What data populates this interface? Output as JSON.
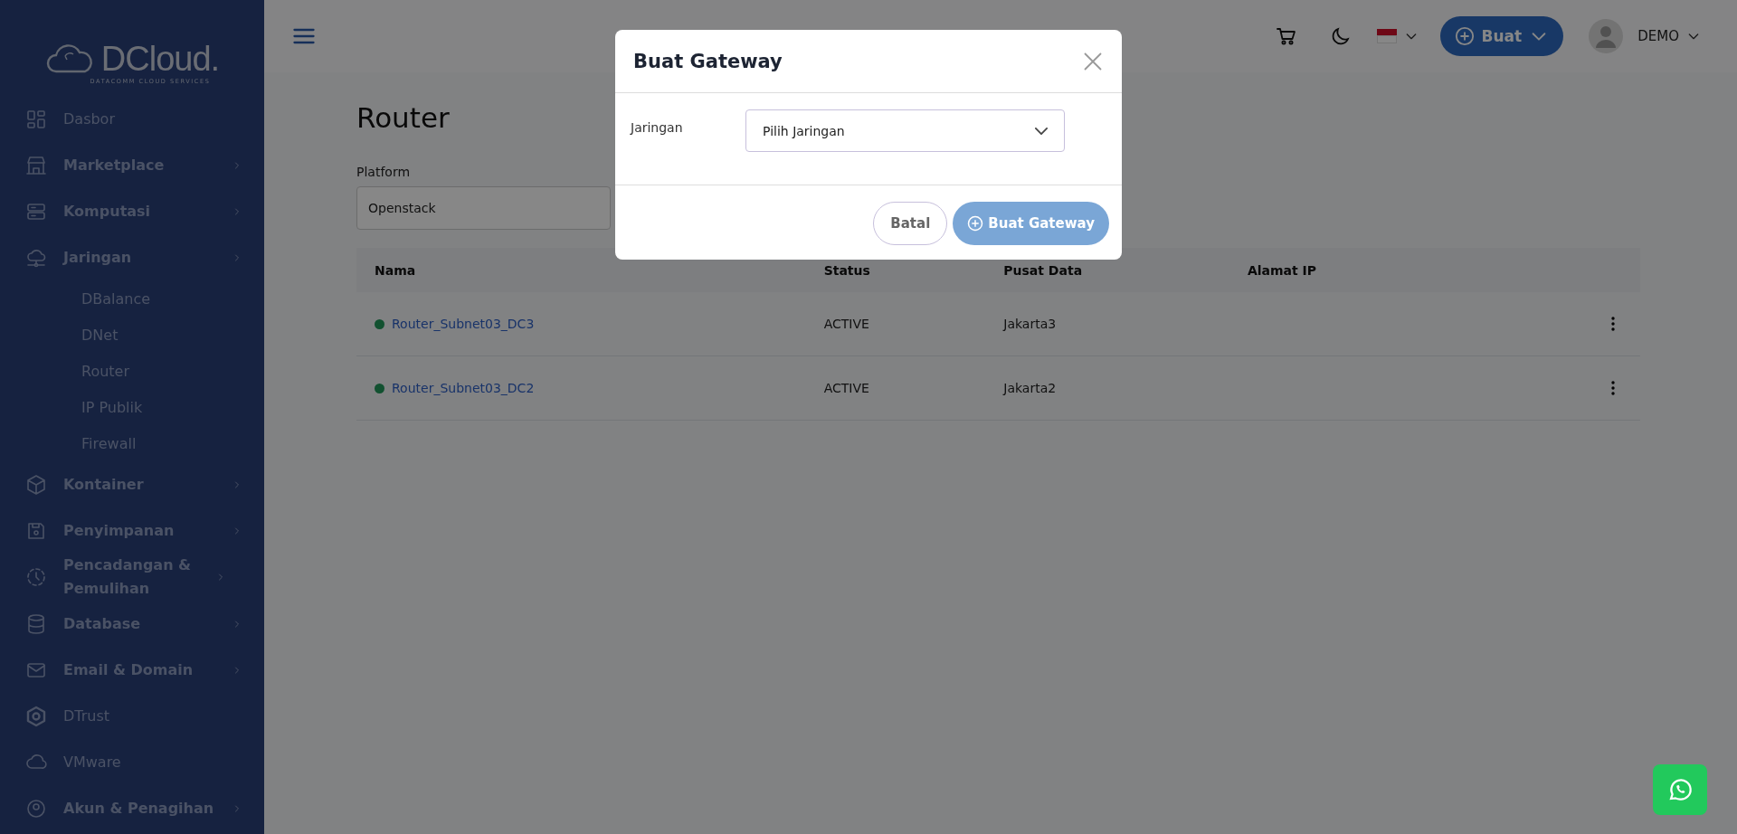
{
  "sidebar": {
    "logo": {
      "name": "DCloud.",
      "tagline": "DATACOMM CLOUD SERVICES"
    },
    "items": [
      {
        "label": "Dasbor",
        "expandable": false
      },
      {
        "label": "Marketplace",
        "expandable": true
      },
      {
        "label": "Komputasi",
        "expandable": true
      },
      {
        "label": "Jaringan",
        "expandable": true,
        "children": [
          {
            "label": "DBalance"
          },
          {
            "label": "DNet"
          },
          {
            "label": "Router"
          },
          {
            "label": "IP Publik"
          },
          {
            "label": "Firewall"
          }
        ]
      },
      {
        "label": "Kontainer",
        "expandable": true
      },
      {
        "label": "Penyimpanan",
        "expandable": true
      },
      {
        "label": "Pencadangan & Pemulihan",
        "expandable": true
      },
      {
        "label": "Database",
        "expandable": true
      },
      {
        "label": "Email & Domain",
        "expandable": true
      },
      {
        "label": "DTrust",
        "expandable": false
      },
      {
        "label": "VMware",
        "expandable": false
      },
      {
        "label": "Akun & Penagihan",
        "expandable": true
      }
    ]
  },
  "header": {
    "create_button": "Buat",
    "user": "DEMO"
  },
  "page": {
    "title": "Router",
    "platform": {
      "label": "Platform",
      "value": "Openstack"
    },
    "table": {
      "columns": [
        "Nama",
        "Status",
        "Pusat Data",
        "Alamat IP"
      ],
      "rows": [
        {
          "name": "Router_Subnet03_DC3",
          "status": "ACTIVE",
          "datacenter": "Jakarta3"
        },
        {
          "name": "Router_Subnet03_DC2",
          "status": "ACTIVE",
          "datacenter": "Jakarta2"
        }
      ]
    }
  },
  "dialog": {
    "title": "Buat Gateway",
    "field_label": "Jaringan",
    "select_placeholder": "Pilih Jaringan",
    "cancel": "Batal",
    "submit": {
      "label": "Buat Gateway",
      "disabled": true
    }
  }
}
